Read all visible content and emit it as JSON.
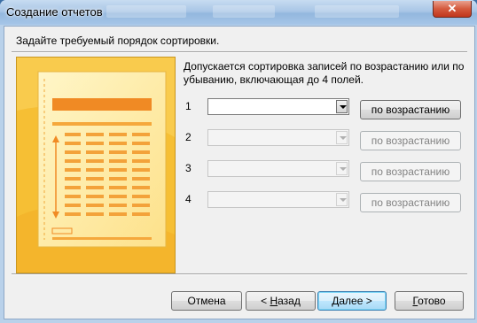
{
  "window": {
    "title": "Создание отчетов",
    "close_label": "✕"
  },
  "heading": "Задайте требуемый порядок сортировки.",
  "description": "Допускается сортировка записей по возрастанию или по убыванию, включающая до 4 полей.",
  "sort_rows": [
    {
      "number": "1",
      "field_value": "",
      "order_label": "по возрастанию",
      "enabled": true
    },
    {
      "number": "2",
      "field_value": "",
      "order_label": "по возрастанию",
      "enabled": false
    },
    {
      "number": "3",
      "field_value": "",
      "order_label": "по возрастанию",
      "enabled": false
    },
    {
      "number": "4",
      "field_value": "",
      "order_label": "по возрастанию",
      "enabled": false
    }
  ],
  "footer": {
    "cancel": "Отмена",
    "back_prefix": "< ",
    "back_accel": "Н",
    "back_rest": "азад",
    "next_prefix": "",
    "next_accel": "Д",
    "next_rest": "алее >",
    "finish_prefix": "",
    "finish_accel": "Г",
    "finish_rest": "отово"
  },
  "colors": {
    "illustration_bg": "#f7c433",
    "illustration_accent": "#f08a24",
    "titlebar": "#a9c6e6"
  }
}
